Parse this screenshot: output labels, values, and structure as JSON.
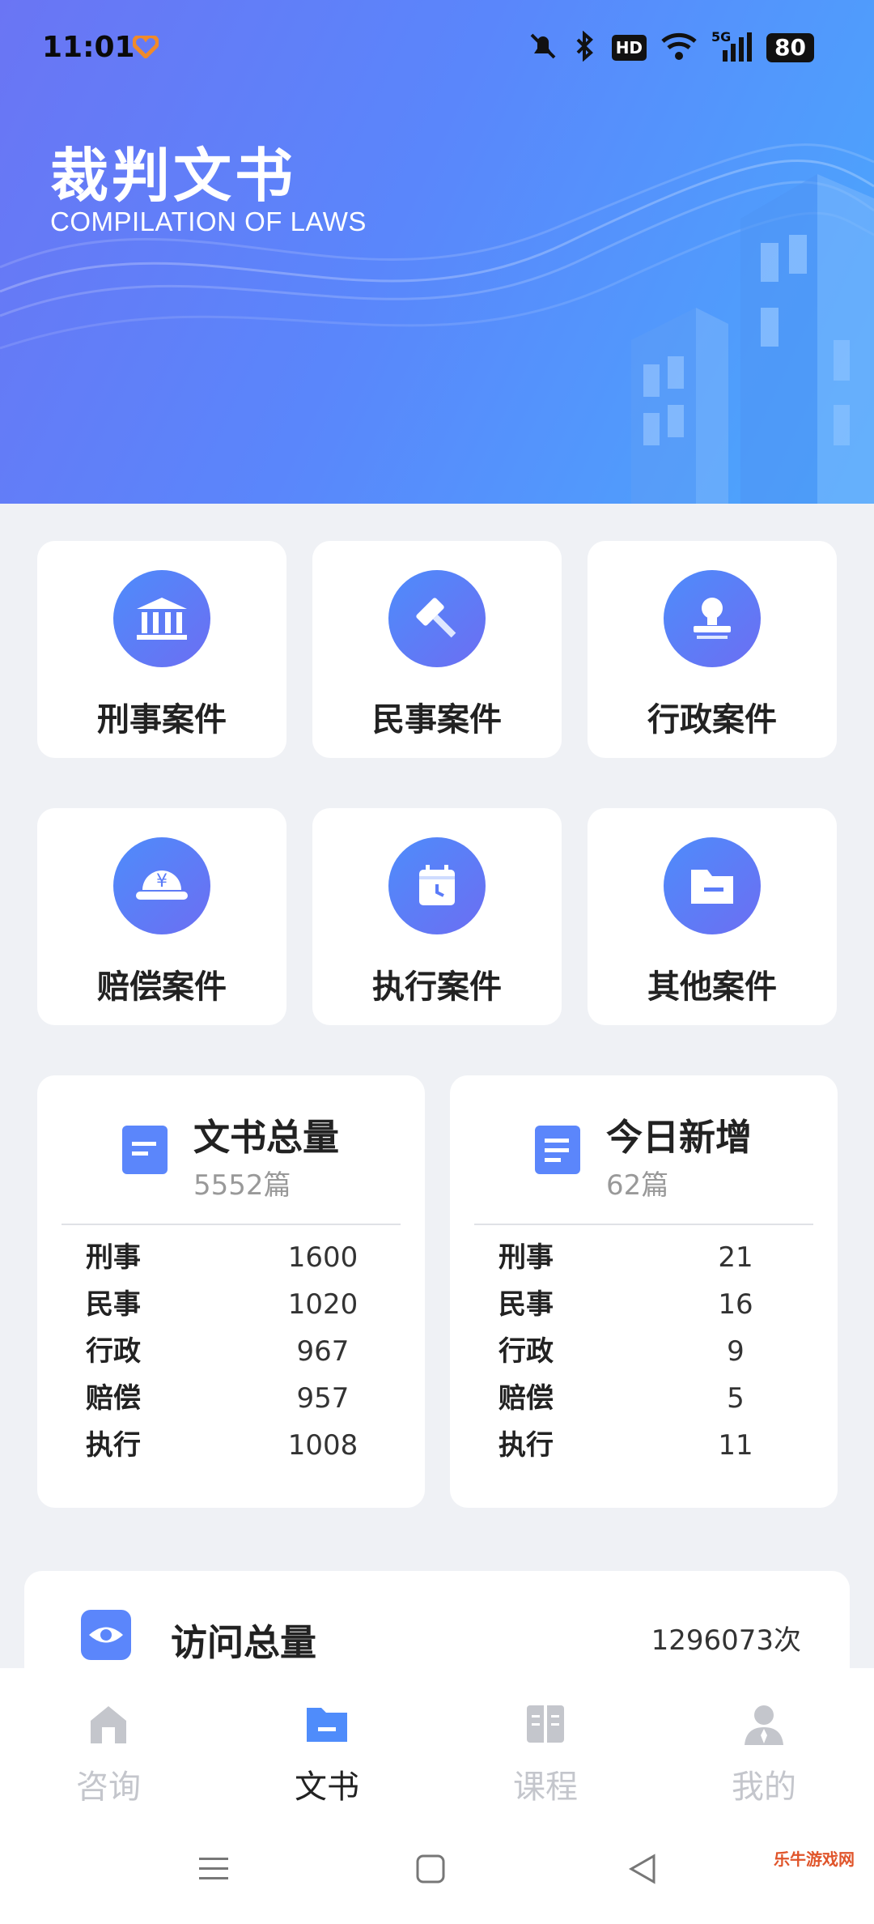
{
  "status_bar": {
    "time": "11:01",
    "hd": "HD",
    "signal": "5G",
    "battery": "80"
  },
  "header": {
    "title": "裁判文书",
    "subtitle": "COMPILATION OF LAWS"
  },
  "categories": [
    {
      "label": "刑事案件",
      "icon": "courthouse-icon"
    },
    {
      "label": "民事案件",
      "icon": "gavel-icon"
    },
    {
      "label": "行政案件",
      "icon": "stamp-icon"
    },
    {
      "label": "赔偿案件",
      "icon": "yuan-coin-icon"
    },
    {
      "label": "执行案件",
      "icon": "calendar-clock-icon"
    },
    {
      "label": "其他案件",
      "icon": "folder-icon"
    }
  ],
  "stats": {
    "total": {
      "title": "文书总量",
      "count": "5552篇",
      "rows": [
        {
          "k": "刑事",
          "v": "1600"
        },
        {
          "k": "民事",
          "v": "1020"
        },
        {
          "k": "行政",
          "v": "967"
        },
        {
          "k": "赔偿",
          "v": "957"
        },
        {
          "k": "执行",
          "v": "1008"
        }
      ]
    },
    "today": {
      "title": "今日新增",
      "count": "62篇",
      "rows": [
        {
          "k": "刑事",
          "v": "21"
        },
        {
          "k": "民事",
          "v": "16"
        },
        {
          "k": "行政",
          "v": "9"
        },
        {
          "k": "赔偿",
          "v": "5"
        },
        {
          "k": "执行",
          "v": "11"
        }
      ]
    }
  },
  "visits": {
    "title": "访问总量",
    "value": "1296073次"
  },
  "tabs": [
    {
      "label": "咨询",
      "icon": "home-icon"
    },
    {
      "label": "文书",
      "icon": "folder-icon"
    },
    {
      "label": "课程",
      "icon": "book-icon"
    },
    {
      "label": "我的",
      "icon": "user-icon"
    }
  ],
  "watermark": "乐牛游戏网",
  "colors": {
    "accent": "#5b7cf8",
    "header_start": "#6a75f4",
    "header_end": "#4aa9fd"
  }
}
